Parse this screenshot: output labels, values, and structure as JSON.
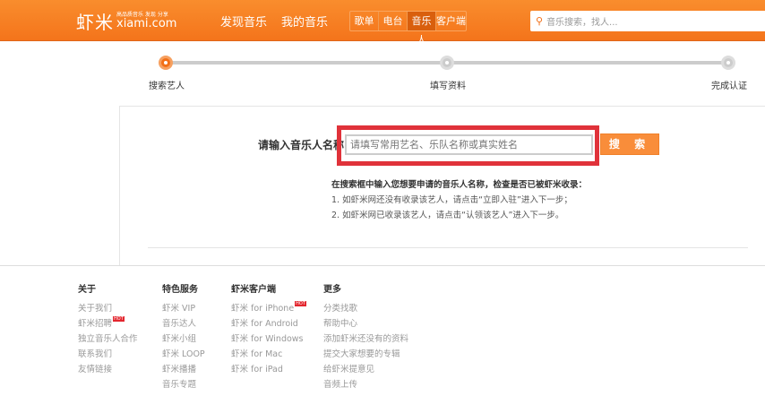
{
  "header": {
    "logo_cn": "虾米",
    "logo_slogan": "高品质音乐 发现 分享",
    "logo_domain": "xiami.com",
    "nav": [
      "发现音乐",
      "我的音乐"
    ],
    "tabs": [
      "歌单",
      "电台",
      "音乐人",
      "客户端"
    ],
    "active_tab": "音乐人",
    "search_placeholder": "音乐搜索，找人..."
  },
  "steps": [
    {
      "label": "搜索艺人",
      "active": true
    },
    {
      "label": "填写资料",
      "active": false
    },
    {
      "label": "完成认证",
      "active": false
    }
  ],
  "form": {
    "label": "请输入音乐人名称",
    "input_placeholder": "请填写常用艺名、乐队名称或真实姓名",
    "search_button": "搜 索",
    "instructions_title": "在搜索框中输入您想要申请的音乐人名称，检查是否已被虾米收录：",
    "instructions": [
      "1. 如虾米网还没有收录该艺人，请点击“立即入驻”进入下一步；",
      "2. 如虾米网已收录该艺人，请点击“认领该艺人”进入下一步。"
    ]
  },
  "footer": {
    "hot_badge": "HOT",
    "columns": [
      {
        "title": "关于",
        "items": [
          {
            "t": "关于我们"
          },
          {
            "t": "虾米招聘",
            "hot": true
          },
          {
            "t": "独立音乐人合作"
          },
          {
            "t": "联系我们"
          },
          {
            "t": "友情链接"
          }
        ]
      },
      {
        "title": "特色服务",
        "items": [
          {
            "t": "虾米 VIP"
          },
          {
            "t": "音乐达人"
          },
          {
            "t": "虾米小组"
          },
          {
            "t": "虾米 LOOP"
          },
          {
            "t": "虾米播播"
          },
          {
            "t": "音乐专题"
          }
        ]
      },
      {
        "title": "虾米客户端",
        "items": [
          {
            "t": "虾米 for iPhone",
            "hot": true
          },
          {
            "t": "虾米 for Android"
          },
          {
            "t": "虾米 for Windows"
          },
          {
            "t": "虾米 for Mac"
          },
          {
            "t": "虾米 for iPad"
          }
        ]
      },
      {
        "title": "更多",
        "items": [
          {
            "t": "分类找歌"
          },
          {
            "t": "帮助中心"
          },
          {
            "t": "添加虾米还没有的资料"
          },
          {
            "t": "提交大家想要的专辑"
          },
          {
            "t": "给虾米提意见"
          },
          {
            "t": "音频上传"
          }
        ]
      }
    ]
  },
  "colors": {
    "brand": "#f4761c",
    "highlight": "#e0323a"
  }
}
